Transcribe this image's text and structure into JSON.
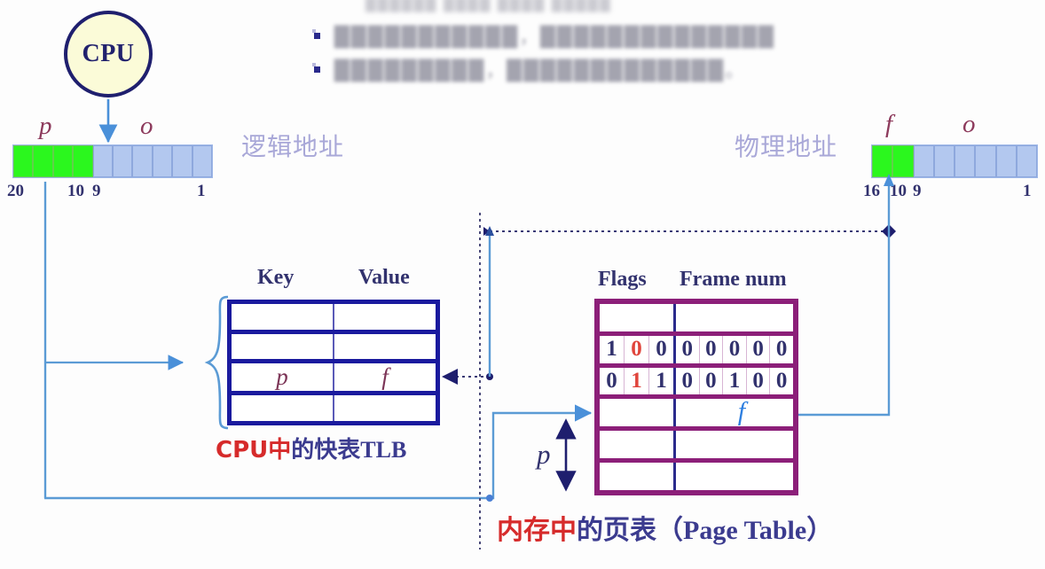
{
  "diagram": {
    "title_hidden": "",
    "cpu": {
      "label": "CPU"
    },
    "header_notes": {
      "line0": "██████ ████ ████ █████",
      "line1": "███████████，██████████████",
      "line2": "█████████，█████████████。"
    },
    "logical_address": {
      "caption": "逻辑地址",
      "field_p": "p",
      "field_o": "o",
      "bit_high": "20",
      "bit_split_high": "10",
      "bit_split_low": "9",
      "bit_low": "1",
      "green_cells": 4,
      "blue_cells": 6
    },
    "physical_address": {
      "caption": "物理地址",
      "field_f": "f",
      "field_o": "o",
      "bit_high": "16",
      "bit_split_high": "10",
      "bit_split_low": "9",
      "bit_low": "1",
      "green_cells": 2,
      "blue_cells": 6
    },
    "tlb": {
      "col_key": "Key",
      "col_value": "Value",
      "rows": [
        {
          "key": "",
          "value": ""
        },
        {
          "key": "",
          "value": ""
        },
        {
          "key": "p",
          "value": "f"
        },
        {
          "key": "",
          "value": ""
        }
      ],
      "caption_red": "CPU中",
      "caption_navy": "的快表",
      "caption_navy_tail": "TLB"
    },
    "page_table": {
      "col_flags": "Flags",
      "col_frame": "Frame num",
      "rows": [
        {
          "flags": [],
          "frame": [],
          "frame_text": ""
        },
        {
          "flags": [
            "1",
            "0",
            "0"
          ],
          "flags_red_index": 1,
          "frame": [
            "0",
            "0",
            "0",
            "0",
            "0"
          ],
          "frame_text": ""
        },
        {
          "flags": [
            "0",
            "1",
            "1"
          ],
          "flags_red_index": 1,
          "frame": [
            "0",
            "0",
            "1",
            "0",
            "0"
          ],
          "frame_text": ""
        },
        {
          "flags": [],
          "frame": [],
          "frame_text": "f"
        },
        {
          "flags": [],
          "frame": [],
          "frame_text": ""
        },
        {
          "flags": [],
          "frame": [],
          "frame_text": ""
        }
      ],
      "offset_marker": "p",
      "caption_red": "内存中",
      "caption_navy": "的页表",
      "caption_paren": "（Page Table）"
    },
    "colors": {
      "cpu_fill": "#fbfbd8",
      "cpu_border": "#1f1f6e",
      "green_cell": "#2bf71e",
      "blue_cell": "#b3c8ef",
      "tlb_border": "#1a1a9e",
      "page_table_border": "#8c1f79",
      "connector_blue": "#5b9bd5",
      "accent_red": "#d62b2b",
      "navy_text": "#32326e",
      "cn_label": "#a9a8d8",
      "italic_var": "#8d3a5c"
    }
  }
}
